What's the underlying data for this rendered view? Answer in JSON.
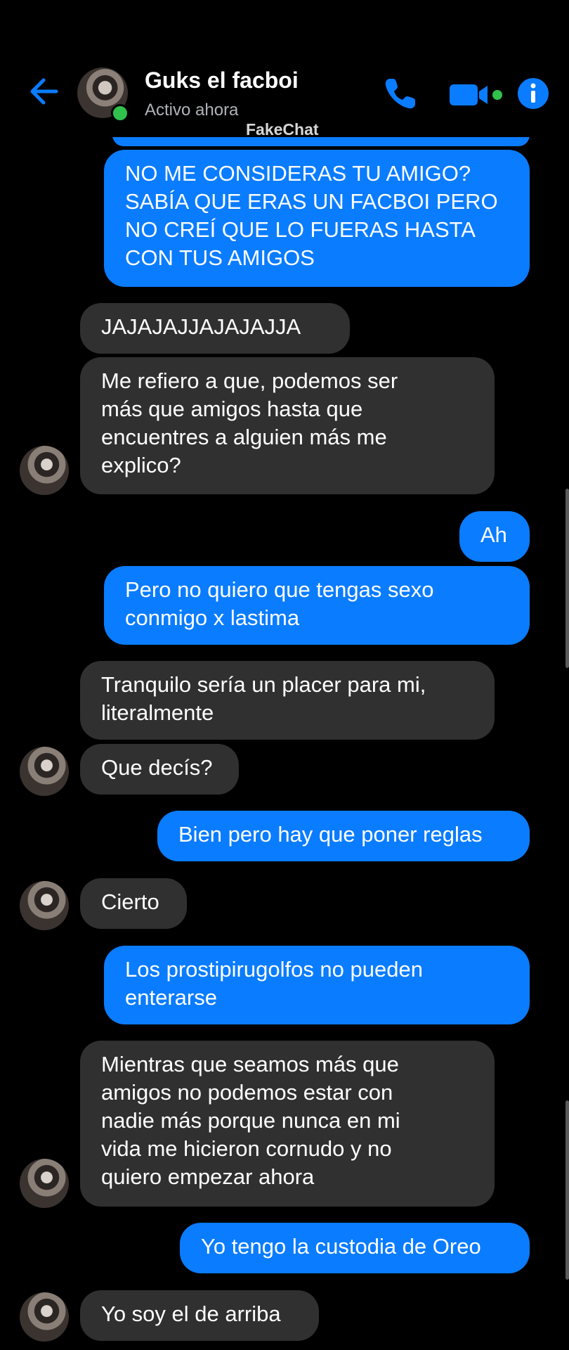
{
  "header": {
    "name": "Guks el facboi",
    "status": "Activo ahora",
    "watermark": "FakeChat",
    "icons": [
      "back-arrow-icon",
      "phone-icon",
      "video-camera-icon",
      "info-icon"
    ],
    "accent": "#0a7cff",
    "online_color": "#31c24d"
  },
  "messages": [
    {
      "from": "me",
      "text": "NO ME CONSIDERAS TU AMIGO?\nSABÍA QUE ERAS UN FACBOI PERO\nNO CREÍ QUE LO FUERAS HASTA\nCON TUS AMIGOS"
    },
    {
      "from": "them",
      "text": "JAJAJAJJAJAJAJJA"
    },
    {
      "from": "them",
      "text": "Me refiero a que, podemos ser\nmás que amigos hasta que\nencuentres a alguien más me\nexplico?"
    },
    {
      "from": "me",
      "text": "Ah"
    },
    {
      "from": "me",
      "text": "Pero no quiero que tengas sexo\nconmigo x lastima"
    },
    {
      "from": "them",
      "text": "Tranquilo sería un placer para mi,\nliteralmente"
    },
    {
      "from": "them",
      "text": "Que decís?"
    },
    {
      "from": "me",
      "text": "Bien pero hay que poner reglas"
    },
    {
      "from": "them",
      "text": "Cierto"
    },
    {
      "from": "me",
      "text": "Los prostipirugolfos no pueden\nenterarse"
    },
    {
      "from": "them",
      "text": "Mientras que seamos más que\namigos no podemos estar con\nnadie más porque nunca en mi\nvida me hicieron cornudo y no\nquiero empezar ahora"
    },
    {
      "from": "me",
      "text": "Yo tengo la custodia de Oreo"
    },
    {
      "from": "them",
      "text": "Yo soy el de arriba"
    }
  ]
}
